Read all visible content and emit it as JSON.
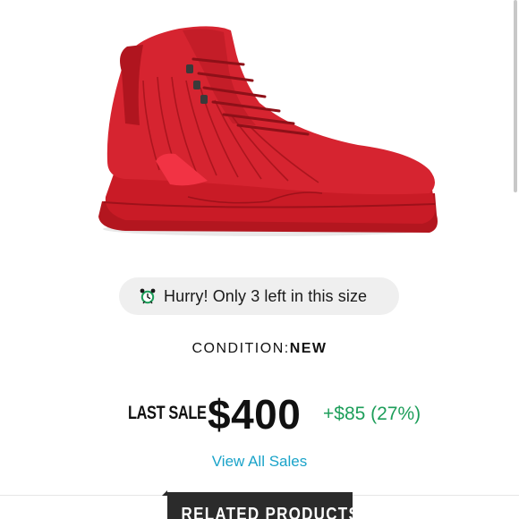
{
  "product": {
    "image_alt": "red high-top sneaker",
    "colors": {
      "shoe_main": "#d11f2a",
      "shoe_shadow": "#a8141d",
      "shoe_dark": "#7e0e14"
    }
  },
  "stock_alert": {
    "icon": "alarm-clock-icon",
    "icon_color": "#1d9e5a",
    "text": "Hurry! Only 3 left in this size"
  },
  "condition": {
    "label": "CONDITION:",
    "value": "NEW"
  },
  "last_sale": {
    "label": "LAST SALE",
    "price": "$400",
    "change": "+$85 (27%)",
    "change_color": "#1d9e5a"
  },
  "links": {
    "view_all_sales": "View All Sales",
    "link_color": "#1aa3c9"
  },
  "related": {
    "tab_label": "RELATED PRODUCTS"
  }
}
